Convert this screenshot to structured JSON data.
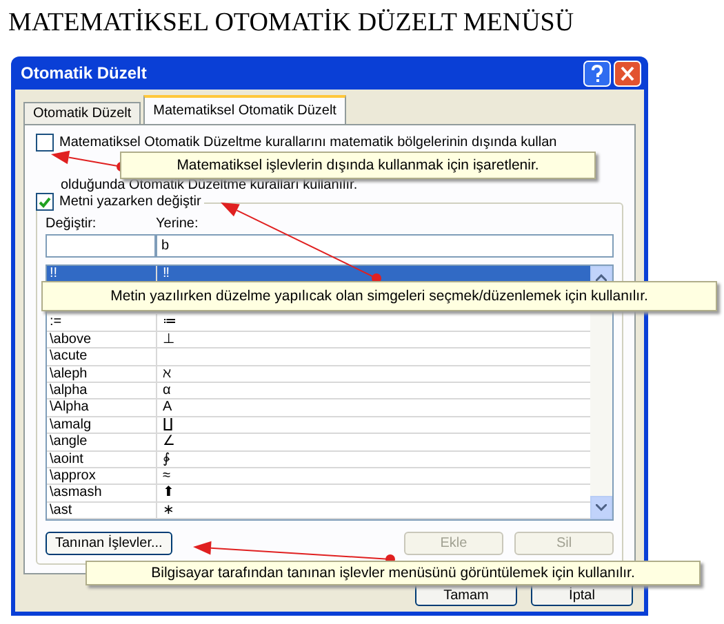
{
  "heading": "MATEMATİKSEL OTOMATİK DÜZELT MENÜSÜ",
  "window": {
    "title": "Otomatik Düzelt"
  },
  "tabs": [
    {
      "label": "Otomatik Düzelt",
      "selected": false
    },
    {
      "label": "Matematiksel Otomatik Düzelt",
      "selected": true
    }
  ],
  "outside_option": {
    "label": "Matematiksel Otomatik Düzeltme kurallarını matematik bölgelerinin dışında kullan",
    "checked": false
  },
  "description": "olduğunda Otomatik Düzeltme kuralları kullanılır.",
  "replace_option": {
    "label": "Metni yazarken değiştir",
    "checked": true
  },
  "fields": {
    "replace_label": "Değiştir:",
    "with_label": "Yerine:",
    "with_value": "b"
  },
  "rows": [
    {
      "replace": "!!",
      "with": "‼",
      "selected": true
    },
    {
      "replace": ":=",
      "with": "≔",
      "selected": false
    },
    {
      "replace": "\\above",
      "with": "⊥",
      "selected": false
    },
    {
      "replace": "\\acute",
      "selected": false
    },
    {
      "replace": "\\aleph",
      "with": "ℵ",
      "selected": false
    },
    {
      "replace": "\\alpha",
      "with": "α",
      "selected": false
    },
    {
      "replace": "\\Alpha",
      "with": "Α",
      "selected": false
    },
    {
      "replace": "\\amalg",
      "with": "∐",
      "selected": false
    },
    {
      "replace": "\\angle",
      "with": "∠",
      "selected": false
    },
    {
      "replace": "\\aoint",
      "with": "∳",
      "selected": false
    },
    {
      "replace": "\\approx",
      "with": "≈",
      "selected": false
    },
    {
      "replace": "\\asmash",
      "with": "⬆",
      "selected": false
    },
    {
      "replace": "\\ast",
      "with": "∗",
      "selected": false
    }
  ],
  "buttons": [
    {
      "label": "Tanınan İşlevler...",
      "disabled": false
    },
    {
      "label": "Ekle",
      "disabled": true
    },
    {
      "label": "Sil",
      "disabled": true
    }
  ],
  "dialog_buttons": [
    "Tamam",
    "İptal"
  ],
  "callouts": [
    "Matematiksel işlevlerin dışında kullanmak için işaretlenir.",
    "Metin yazılırken düzelme yapılıcak olan simgeleri seçmek/düzenlemek için kullanılır.",
    "Bilgisayar tarafından tanınan işlevler menüsünü görüntülemek için kullanılır."
  ]
}
